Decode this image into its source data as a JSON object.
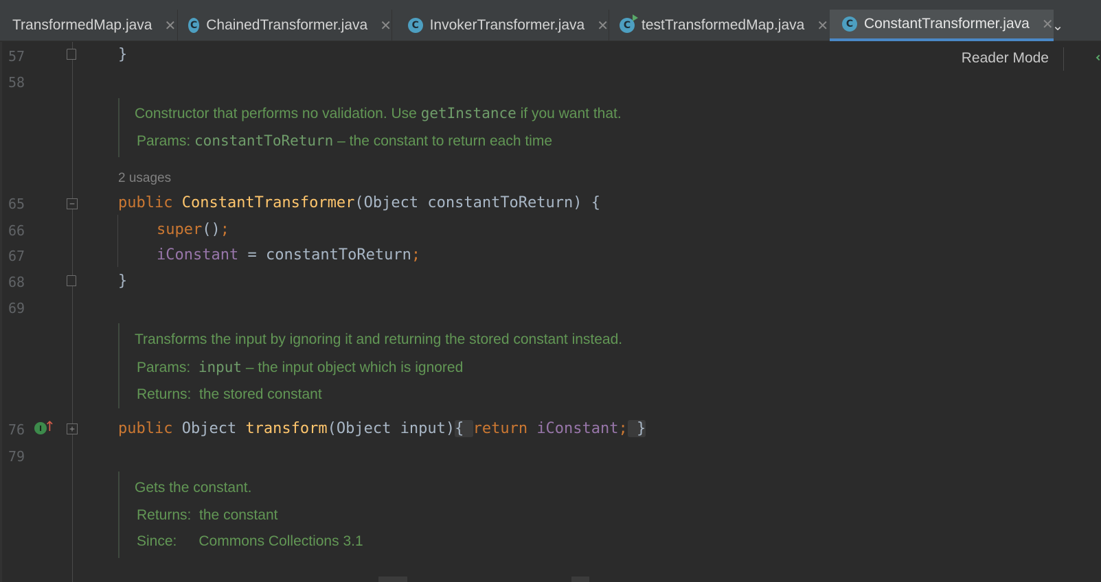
{
  "tabs": [
    {
      "label": "TransformedMap.java",
      "icon": "java-file-icon",
      "active": false
    },
    {
      "label": "ChainedTransformer.java",
      "icon": "class-icon",
      "active": false
    },
    {
      "label": "InvokerTransformer.java",
      "icon": "class-icon",
      "active": false
    },
    {
      "label": "testTransformedMap.java",
      "icon": "runnable-class-icon",
      "active": false
    },
    {
      "label": "ConstantTransformer.java",
      "icon": "class-icon",
      "active": true
    }
  ],
  "tab_close_glyph": "✕",
  "class_icon_letter": "C",
  "editor": {
    "reader_mode": "Reader Mode",
    "line_numbers": [
      "57",
      "58",
      "65",
      "66",
      "67",
      "68",
      "69",
      "76",
      "79"
    ],
    "usages": "2 usages",
    "doc1": {
      "text_before": "Constructor that performs no validation. Use ",
      "code": "getInstance",
      "text_after": " if you want that.",
      "params_label": "Params:",
      "param_name": "constantToReturn",
      "param_desc": " – the constant to return each time"
    },
    "doc2": {
      "text": "Transforms the input by ignoring it and returning the stored constant instead.",
      "params_label": "Params:",
      "param_name": "input",
      "param_desc": " – the input object which is ignored",
      "returns_label": "Returns:",
      "returns_desc": "the stored constant"
    },
    "doc3": {
      "text": "Gets the constant.",
      "returns_label": "Returns:",
      "returns_desc": "the constant",
      "since_label": "Since:",
      "since_desc": "Commons Collections 3.1"
    },
    "code": {
      "brace_close": "}",
      "ctor_public": "public ",
      "ctor_name": "ConstantTransformer",
      "ctor_params": "(Object constantToReturn) {",
      "super_call": "super",
      "super_rest": "()",
      "semicolon": ";",
      "field": "iConstant",
      "assign": " = constantToReturn",
      "m_public": "public ",
      "m_type": "Object ",
      "m_name": "transform",
      "m_params": "(Object input)",
      "m_open": "{ ",
      "m_return": "return ",
      "m_field": "iConstant",
      "m_semi": ";",
      "m_close": " }"
    }
  }
}
